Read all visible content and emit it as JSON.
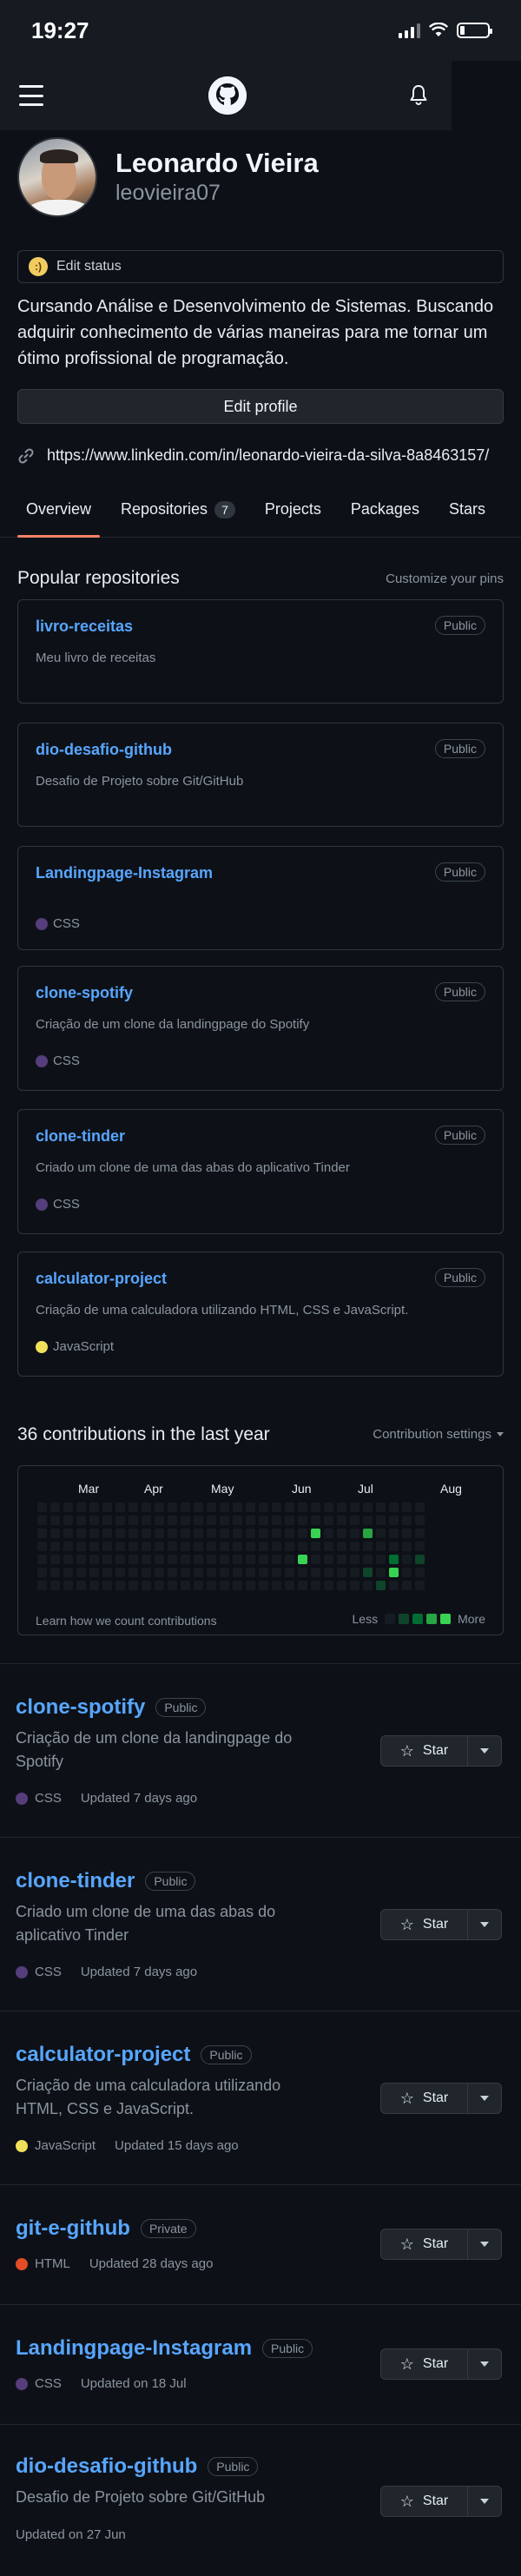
{
  "status_bar": {
    "time": "19:27"
  },
  "profile": {
    "full_name": "Leonardo Vieira",
    "username": "leovieira07",
    "edit_status": "Edit status",
    "bio": "Cursando Análise e Desenvolvimento de Sistemas. Buscando adquirir conhecimento de várias maneiras para me tornar um ótimo profissional de programação.",
    "edit_profile": "Edit profile",
    "link": "https://www.linkedin.com/in/leonardo-vieira-da-silva-8a8463157/"
  },
  "tabs": [
    {
      "label": "Overview",
      "active": true
    },
    {
      "label": "Repositories",
      "count": "7"
    },
    {
      "label": "Projects"
    },
    {
      "label": "Packages"
    },
    {
      "label": "Stars"
    }
  ],
  "popular": {
    "title": "Popular repositories",
    "customize": "Customize your pins",
    "pins": [
      {
        "name": "livro-receitas",
        "badge": "Public",
        "desc": "Meu livro de receitas",
        "lang": "",
        "lang_color": ""
      },
      {
        "name": "dio-desafio-github",
        "badge": "Public",
        "desc": "Desafio de Projeto sobre Git/GitHub",
        "lang": "",
        "lang_color": ""
      },
      {
        "name": "Landingpage-Instagram",
        "badge": "Public",
        "desc": "",
        "lang": "CSS",
        "lang_color": "#563d7c"
      },
      {
        "name": "clone-spotify",
        "badge": "Public",
        "desc": "Criação de um clone da landingpage do Spotify",
        "lang": "CSS",
        "lang_color": "#563d7c"
      },
      {
        "name": "clone-tinder",
        "badge": "Public",
        "desc": "Criado um clone de uma das abas do aplicativo Tinder",
        "lang": "CSS",
        "lang_color": "#563d7c"
      },
      {
        "name": "calculator-project",
        "badge": "Public",
        "desc": "Criação de uma calculadora utilizando HTML, CSS e JavaScript.",
        "lang": "JavaScript",
        "lang_color": "#f1e05a"
      }
    ]
  },
  "contributions": {
    "title": "36 contributions in the last year",
    "settings": "Contribution settings",
    "months": [
      "Mar",
      "Apr",
      "May",
      "Jun",
      "Jul",
      "Aug"
    ],
    "learn": "Learn how we count contributions",
    "less": "Less",
    "more": "More",
    "colors": [
      "#161b22",
      "#0e4429",
      "#006d32",
      "#26a641",
      "#39d353"
    ]
  },
  "repos": [
    {
      "name": "clone-spotify",
      "badge": "Public",
      "desc": "Criação de um clone da landingpage do Spotify",
      "lang": "CSS",
      "lang_color": "#563d7c",
      "updated": "Updated 7 days ago",
      "star": "Star"
    },
    {
      "name": "clone-tinder",
      "badge": "Public",
      "desc": "Criado um clone de uma das abas do aplicativo Tinder",
      "lang": "CSS",
      "lang_color": "#563d7c",
      "updated": "Updated 7 days ago",
      "star": "Star"
    },
    {
      "name": "calculator-project",
      "badge": "Public",
      "desc": "Criação de uma calculadora utilizando HTML, CSS e JavaScript.",
      "lang": "JavaScript",
      "lang_color": "#f1e05a",
      "updated": "Updated 15 days ago",
      "star": "Star"
    },
    {
      "name": "git-e-github",
      "badge": "Private",
      "desc": "",
      "lang": "HTML",
      "lang_color": "#e34c26",
      "updated": "Updated 28 days ago",
      "star": "Star"
    },
    {
      "name": "Landingpage-Instagram",
      "badge": "Public",
      "desc": "",
      "lang": "CSS",
      "lang_color": "#563d7c",
      "updated": "Updated on 18 Jul",
      "star": "Star"
    },
    {
      "name": "dio-desafio-github",
      "badge": "Public",
      "desc": "Desafio de Projeto sobre Git/GitHub",
      "lang": "",
      "lang_color": "",
      "updated": "Updated on 27 Jun",
      "star": "Star"
    }
  ]
}
